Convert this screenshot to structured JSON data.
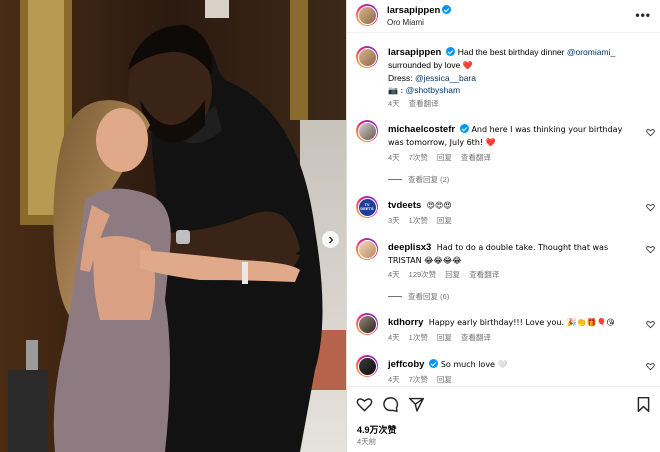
{
  "post": {
    "username": "larsapippen",
    "location": "Oro Miami",
    "more_icon": "more-horizontal-icon"
  },
  "caption": {
    "username": "larsapippen",
    "text_1": "Had the best birthday dinner",
    "mention_venue": "@oromiami_",
    "text_2": "surrounded by love",
    "heart": "❤️",
    "dress_label": "Dress:",
    "mention_dress": "@jessica__bara",
    "camera": "📷 :",
    "mention_photo": "@shotbysham",
    "time": "4天",
    "translate": "查看翻译"
  },
  "comments": [
    {
      "username": "michaelcostefr",
      "verified": true,
      "text": "And here I was thinking your birthday was tomorrow, July 6th! ❤️",
      "time": "4天",
      "likes": "7次赞",
      "reply": "回复",
      "translate": "查看翻译",
      "replies": "查看回复 (2)"
    },
    {
      "username": "tvdeets",
      "verified": false,
      "text": "😍😍😍",
      "time": "3天",
      "likes": "1次赞",
      "reply": "回复"
    },
    {
      "username": "deeplisx3",
      "verified": false,
      "text": "Had to do a double take. Thought that was TRISTAN 😂😂😂😂",
      "time": "4天",
      "likes": "129次赞",
      "reply": "回复",
      "translate": "查看翻译",
      "replies": "查看回复 (6)"
    },
    {
      "username": "kdhorry",
      "verified": false,
      "text": "Happy early birthday!!! Love you. 🎉👏🎁🎈😘",
      "time": "4天",
      "likes": "1次赞",
      "reply": "回复",
      "translate": "查看翻译"
    },
    {
      "username": "jeffcoby",
      "verified": true,
      "text": "So much love 🤍",
      "time": "4天",
      "likes": "7次赞",
      "reply": "回复"
    }
  ],
  "footer": {
    "likes": "4.9万次赞",
    "date": "4天前"
  },
  "avatar_labels": {
    "tvdeets": "TV DEETS"
  },
  "colors": {
    "verified": "#0095f6",
    "link": "#00376b",
    "muted": "#737373",
    "heart": "#ed4956"
  }
}
